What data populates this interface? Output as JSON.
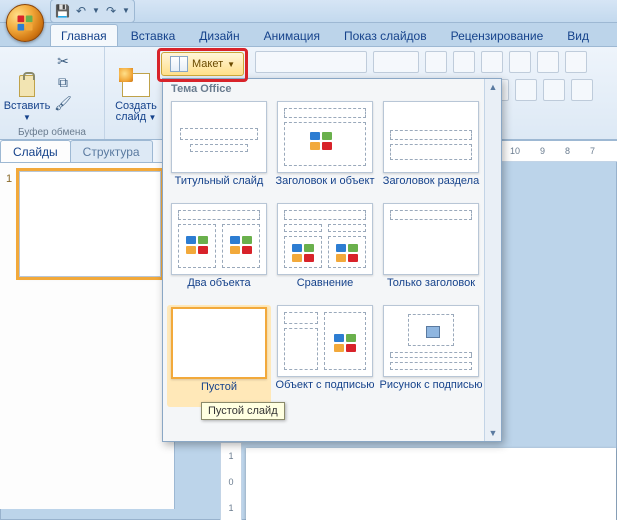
{
  "qat": {
    "save": "💾",
    "undo": "↶",
    "redo": "↷"
  },
  "tabs": {
    "home": "Главная",
    "insert": "Вставка",
    "design": "Дизайн",
    "animation": "Анимация",
    "slideshow": "Показ слайдов",
    "review": "Рецензирование",
    "view": "Вид"
  },
  "ribbon": {
    "paste": "Вставить",
    "clipboard_group": "Буфер обмена",
    "new_slide": "Создать слайд",
    "layout_btn": "Макет"
  },
  "gallery": {
    "title": "Тема Office",
    "layouts": {
      "l0": "Титульный слайд",
      "l1": "Заголовок и объект",
      "l2": "Заголовок раздела",
      "l3": "Два объекта",
      "l4": "Сравнение",
      "l5": "Только заголовок",
      "l6": "Пустой",
      "l7": "Объект с подписью",
      "l8": "Рисунок с подписью"
    }
  },
  "tooltip": "Пустой слайд",
  "left_tabs": {
    "slides": "Слайды",
    "outline": "Структура"
  },
  "slide_number": "1",
  "ruler_ticks": [
    "10",
    "9",
    "8",
    "7"
  ],
  "vruler_ticks": [
    "1",
    "0",
    "1"
  ]
}
